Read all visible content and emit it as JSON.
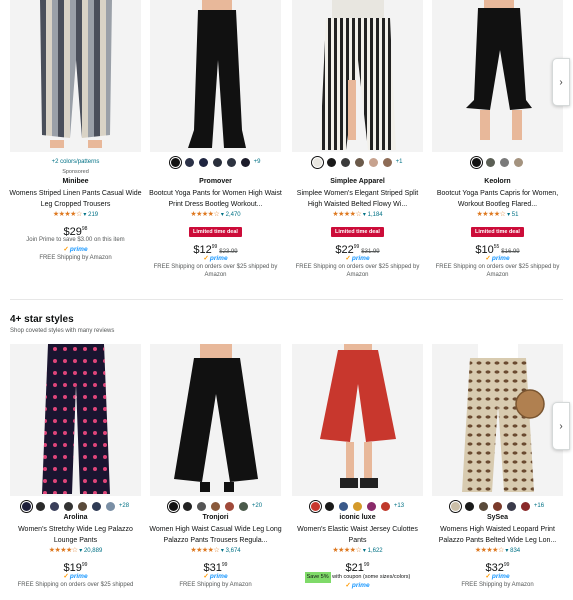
{
  "section1": {
    "products": [
      {
        "colors": [
          "#d9d3c6"
        ],
        "color_link": "+2 colors/patterns",
        "sponsored": "Sponsored",
        "brand": "Minibee",
        "title": "Womens Striped Linen Pants Casual Wide Leg Cropped Trousers",
        "stars": "★★★★☆",
        "reviews": "219",
        "price_whole": "$29",
        "price_frac": "98",
        "join_prime": "Join Prime to save $3.00 on this item",
        "prime": "prime",
        "shipping": "FREE Shipping by Amazon",
        "image": "striped-linen"
      },
      {
        "colors": [
          "#111111",
          "#2b3147",
          "#1f2540",
          "#2a2f3b",
          "#2d3340",
          "#1c1c2a"
        ],
        "more": "+9",
        "brand": "Promover",
        "title": "Bootcut Yoga Pants for Women High Waist Print Dress Bootleg Workout...",
        "stars": "★★★★☆",
        "reviews": "2,470",
        "deal": "Limited time deal",
        "price_whole": "$12",
        "price_frac": "99",
        "old_price": "$23.99",
        "prime": "prime",
        "shipping": "FREE Shipping on orders over $25 shipped by Amazon",
        "image": "black-flare"
      },
      {
        "colors": [
          "#e8e6e0",
          "#1a1a1a",
          "#3b3b3b",
          "#6b5a4a",
          "#c7a28e",
          "#8d6b56"
        ],
        "more": "+1",
        "brand": "Simplee Apparel",
        "title": "Simplee Women's Elegant Striped Split High Waisted Belted Flowy Wi...",
        "stars": "★★★★☆",
        "reviews": "1,184",
        "deal": "Limited time deal",
        "price_whole": "$22",
        "price_frac": "99",
        "old_price": "$31.99",
        "prime": "prime",
        "shipping": "FREE Shipping on orders over $25 shipped by Amazon",
        "image": "striped-split"
      },
      {
        "colors": [
          "#111111",
          "#5b5f55",
          "#7a7a7a",
          "#a4937f"
        ],
        "brand": "Keolorn",
        "title": "Bootcut Yoga Pants Capris for Women, Workout Bootleg Flared...",
        "stars": "★★★★☆",
        "reviews": "51",
        "deal": "Limited time deal",
        "price_whole": "$10",
        "price_frac": "55",
        "old_price": "$16.99",
        "prime": "prime",
        "shipping": "FREE Shipping on orders over $25 shipped by Amazon",
        "image": "black-capri"
      }
    ]
  },
  "section2": {
    "title": "4+ star styles",
    "subtitle": "Shop coveted styles with many reviews",
    "products": [
      {
        "colors": [
          "#1c1e3a",
          "#2b2b2b",
          "#3a3f5a",
          "#333333",
          "#5a4a3a",
          "#2f3b55",
          "#7a8fa5"
        ],
        "more": "+28",
        "brand": "Arolina",
        "title": "Women's Stretchy Wide Leg Palazzo Lounge Pants",
        "stars": "★★★★☆",
        "reviews": "20,889",
        "price_whole": "$19",
        "price_frac": "99",
        "prime": "prime",
        "shipping": "FREE Shipping on orders over $25 shipped",
        "image": "floral-palazzo"
      },
      {
        "colors": [
          "#111111",
          "#222222",
          "#555555",
          "#8a5a3c",
          "#a04a3a",
          "#4a5a4a"
        ],
        "more": "+20",
        "brand": "Tronjori",
        "title": "Women High Waist Casual Wide Leg Long Palazzo Pants Trousers Regula...",
        "stars": "★★★★☆",
        "reviews": "3,674",
        "price_whole": "$31",
        "price_frac": "99",
        "prime": "prime",
        "shipping": "FREE Shipping by Amazon",
        "image": "black-wide"
      },
      {
        "colors": [
          "#c8372d",
          "#1a1a1a",
          "#3a5a8a",
          "#d49a2a",
          "#8a2a6a",
          "#c0392b"
        ],
        "more": "+13",
        "brand": "iconic luxe",
        "title": "Women's Elastic Waist Jersey Culottes Pants",
        "stars": "★★★★☆",
        "reviews": "1,622",
        "price_whole": "$21",
        "price_frac": "99",
        "save_badge": "Save 5%",
        "coupon": "with coupon (some sizes/colors)",
        "prime": "prime",
        "image": "red-culottes"
      },
      {
        "colors": [
          "#cbbfa8",
          "#1a1a1a",
          "#5a4a3a",
          "#7a3a2a",
          "#3a3a4a",
          "#8a2a2a"
        ],
        "more": "+16",
        "brand": "SySea",
        "title": "Womens High Waisted Leopard Print Palazzo Pants Belted Wide Leg Lon...",
        "stars": "★★★★☆",
        "reviews": "834",
        "price_whole": "$32",
        "price_frac": "99",
        "prime": "prime",
        "shipping": "FREE Shipping by Amazon",
        "image": "leopard-palazzo"
      }
    ]
  },
  "nav": {
    "next_arrow": "›"
  }
}
